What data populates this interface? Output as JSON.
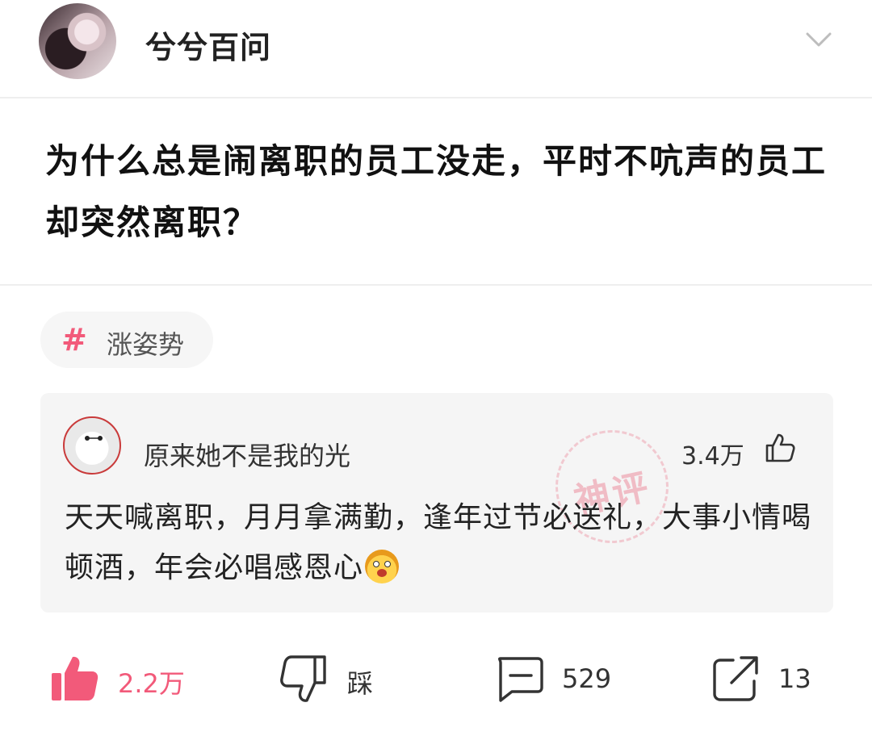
{
  "author": {
    "name": "兮兮百问"
  },
  "question": {
    "title": "为什么总是闹离职的员工没走，平时不吭声的员工却突然离职？"
  },
  "tag": {
    "label": "涨姿势"
  },
  "top_comment": {
    "user": "原来她不是我的光",
    "likes": "3.4万",
    "stamp": "神评",
    "text": "天天喊离职，月月拿满勤，逢年过节必送礼，大事小情喝顿酒，年会必唱感恩心"
  },
  "actions": {
    "like_count": "2.2万",
    "dislike_label": "踩",
    "comment_count": "529",
    "share_count": "13"
  },
  "colors": {
    "accent": "#f25a7a",
    "card_bg": "#f5f5f5",
    "tag_bg": "#f6f6f6"
  }
}
